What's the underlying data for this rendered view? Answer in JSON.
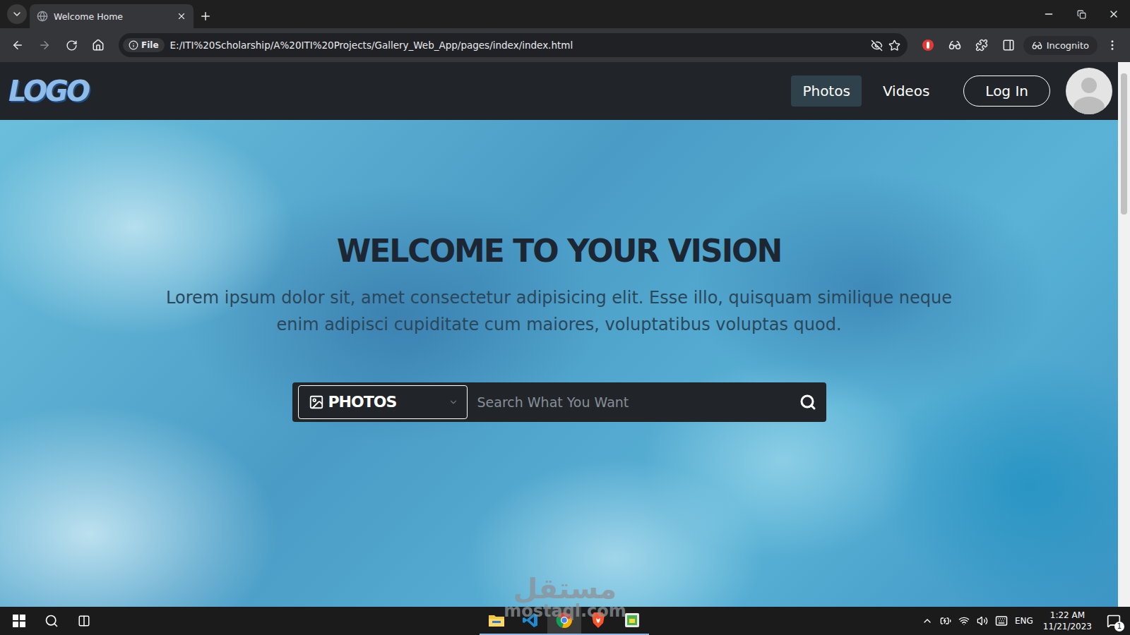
{
  "browser": {
    "tabs": [
      {
        "title": "Welcome Home",
        "selected": true
      }
    ],
    "address": {
      "scheme": "File",
      "url": "E:/ITI%20Scholarship/A%20ITI%20Projects/Gallery_Web_App/pages/index/index.html"
    },
    "profile": "Incognito"
  },
  "navbar": {
    "logo": "LOGO",
    "items": [
      {
        "label": "Photos",
        "selected": true
      },
      {
        "label": "Videos",
        "selected": false
      }
    ],
    "login": "Log In"
  },
  "hero": {
    "title": "WELCOME TO YOUR VISION",
    "text": "Lorem ipsum dolor sit, amet consectetur adipisicing elit. Esse illo, quisquam similique neque enim adipisci cupiditate cum maiores, voluptatibus voluptas quod.",
    "search": {
      "category": "PHOTOS",
      "placeholder": "Search What You Want"
    }
  },
  "taskbar": {
    "apps": [
      {
        "kind": "explorer",
        "selected": false
      },
      {
        "kind": "vscode",
        "selected": false
      },
      {
        "kind": "chrome",
        "selected": true
      },
      {
        "kind": "brave",
        "selected": false
      },
      {
        "kind": "app",
        "selected": false
      }
    ],
    "language": "ENG",
    "time": "1:22 AM",
    "date": "11/21/2023",
    "notifications": "1"
  },
  "watermark": {
    "arabic": "مستقل",
    "latin": "mostaql.com"
  }
}
